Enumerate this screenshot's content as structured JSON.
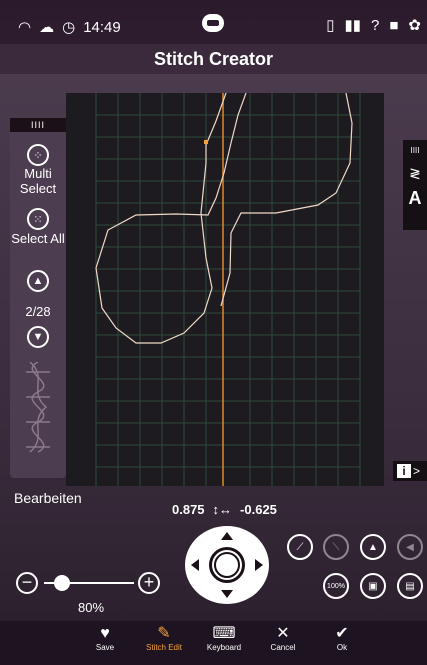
{
  "status": {
    "time": "14:49"
  },
  "title": "Stitch Creator",
  "left_panel": {
    "handle": "IIII",
    "multi_select": "Multi Select",
    "select_all": "Select All",
    "page": "2/28"
  },
  "right_tab": {
    "handle": "IIII",
    "letter": "A"
  },
  "info_button": "i",
  "edit_label": "Bearbeiten",
  "coords": {
    "x": "0.875",
    "y": "-0.625",
    "symbol": "↕↔"
  },
  "zoom": {
    "percent": "80%",
    "level": 0.2
  },
  "tools": {
    "btn_100": "100%"
  },
  "nav": [
    {
      "label": "Save",
      "icon": "heart-icon",
      "glyph": "♥"
    },
    {
      "label": "Stitch Edit",
      "icon": "stitch-edit-icon",
      "glyph": "✎",
      "active": true
    },
    {
      "label": "Keyboard",
      "icon": "keyboard-icon",
      "glyph": "⌨"
    },
    {
      "label": "Cancel",
      "icon": "close-icon",
      "glyph": "✕"
    },
    {
      "label": "Ok",
      "icon": "check-icon",
      "glyph": "✔"
    }
  ],
  "colors": {
    "accent": "#f6a23c",
    "stitch": "#f2d9c8",
    "grid": "#2f4a3d"
  }
}
